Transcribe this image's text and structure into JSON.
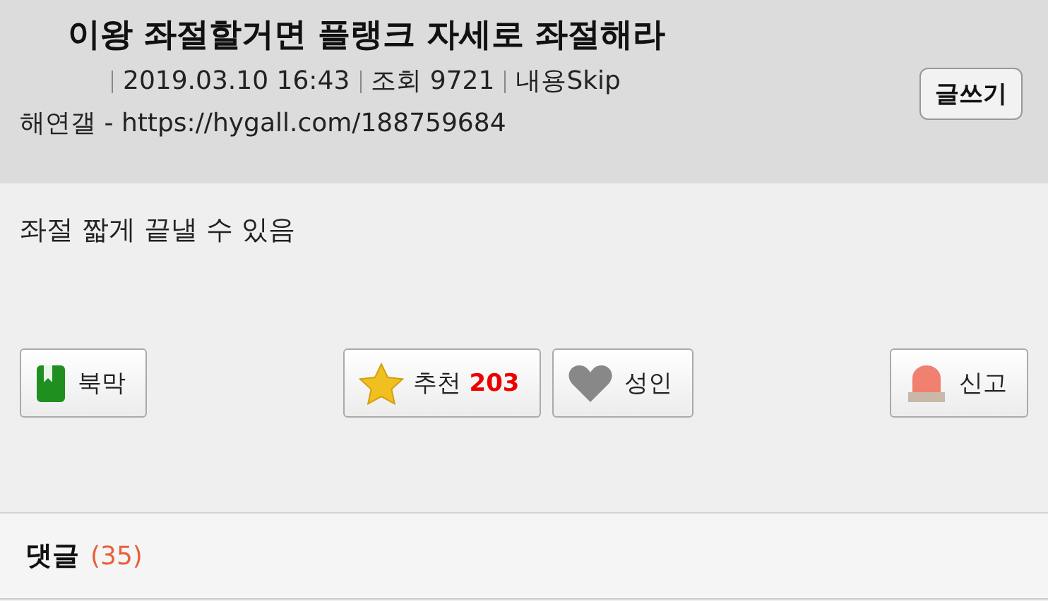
{
  "post": {
    "title": "이왕 좌절할거면 플랭크 자세로 좌절해라",
    "meta": [
      "2019.03.10 16:43",
      "조회 9721",
      "내용Skip"
    ],
    "source": "해연갤 - https://hygall.com/188759684",
    "write_button": "글쓰기",
    "body": "좌절 짧게 끝낼 수 있음"
  },
  "actions": [
    {
      "kind": "bookmark",
      "label": "북막"
    },
    {
      "kind": "recommend",
      "label": "추천",
      "count": "203"
    },
    {
      "kind": "adult",
      "label": "성인"
    },
    {
      "kind": "report",
      "label": "신고"
    }
  ],
  "comments": {
    "label": "댓글",
    "count": "(35)"
  }
}
